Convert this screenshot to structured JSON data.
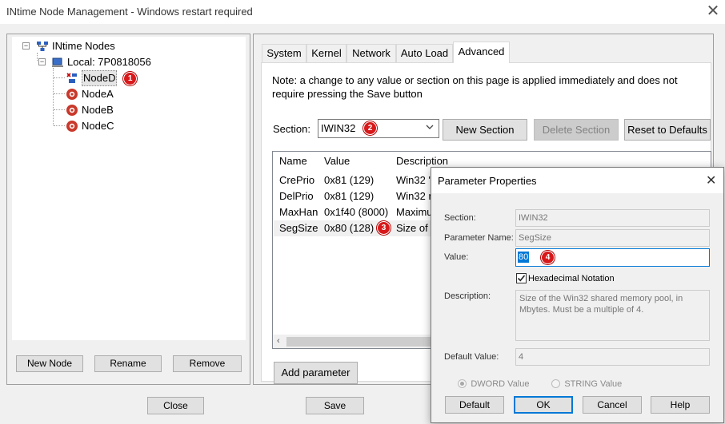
{
  "window": {
    "title": "INtime Node Management - Windows restart required"
  },
  "tree": {
    "root_label": "INtime Nodes",
    "local_label": "Local: 7P0818056",
    "nodes": [
      {
        "label": "NodeD",
        "badge": "1",
        "selected": true
      },
      {
        "label": "NodeA"
      },
      {
        "label": "NodeB"
      },
      {
        "label": "NodeC"
      }
    ]
  },
  "left_buttons": {
    "new_node": "New Node",
    "rename": "Rename",
    "remove": "Remove"
  },
  "bottom_buttons": {
    "close": "Close",
    "save": "Save"
  },
  "tabs": [
    "System",
    "Kernel",
    "Network",
    "Auto Load",
    "Advanced"
  ],
  "active_tab": "Advanced",
  "advanced": {
    "note": "Note: a change to any value or section on this page is applied immediately and does not require pressing the Save button",
    "section_label": "Section:",
    "section_value": "IWIN32",
    "section_badge": "2",
    "buttons": {
      "new_section": "New Section",
      "delete_section": "Delete Section",
      "reset_defaults": "Reset to Defaults"
    },
    "columns": [
      "Name",
      "Value",
      "Description"
    ],
    "rows": [
      {
        "name": "CrePrio",
        "value": "0x81 (129)",
        "desc": "Win32 \""
      },
      {
        "name": "DelPrio",
        "value": "0x81 (129)",
        "desc": "Win32 n"
      },
      {
        "name": "MaxHan",
        "value": "0x1f40 (8000)",
        "desc": "Maximu"
      },
      {
        "name": "SegSize",
        "value": "0x80 (128)",
        "desc": "Size of t",
        "badge": "3"
      }
    ],
    "add_parameter": "Add parameter"
  },
  "dialog": {
    "title": "Parameter Properties",
    "section_label": "Section:",
    "section_value": "IWIN32",
    "param_name_label": "Parameter Name:",
    "param_name_value": "SegSize",
    "value_label": "Value:",
    "value": "80",
    "value_badge": "4",
    "hex_label": "Hexadecimal Notation",
    "hex_checked": true,
    "description_label": "Description:",
    "description": "Size of the Win32 shared memory pool, in Mbytes. Must be a multiple of 4.",
    "default_label": "Default Value:",
    "default_value": "4",
    "radio_dword": "DWORD Value",
    "radio_string": "STRING Value",
    "buttons": {
      "default": "Default",
      "ok": "OK",
      "cancel": "Cancel",
      "help": "Help"
    }
  },
  "colors": {
    "badge": "#d7191b",
    "focus": "#0078d7",
    "selection": "#0078d7"
  }
}
